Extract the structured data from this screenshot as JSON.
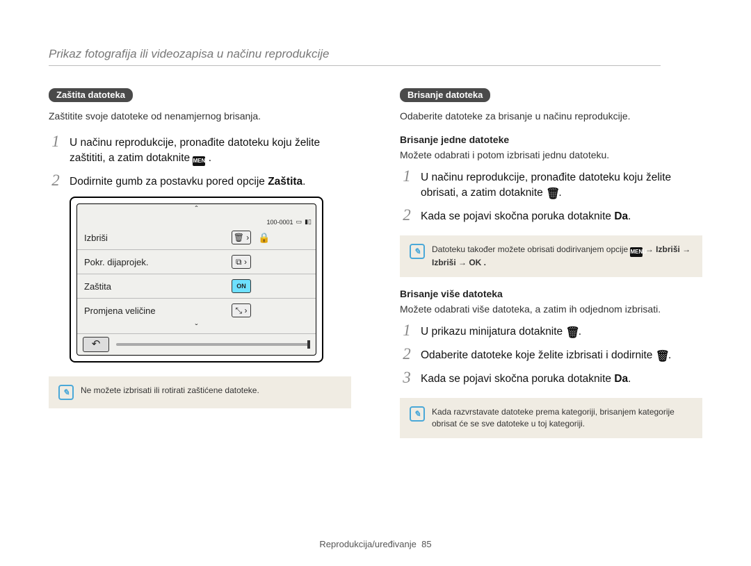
{
  "page_header": "Prikaz fotografija ili videozapisa u načinu reprodukcije",
  "footer": {
    "label": "Reprodukcija/uređivanje",
    "page": "85"
  },
  "left": {
    "pill": "Zaštita datoteka",
    "intro": "Zaštitite svoje datoteke od nenamjernog brisanja.",
    "steps": [
      "U načinu reprodukcije, pronađite datoteku koju želite zaštititi, a zatim dotaknite ",
      "Dodirnite gumb za postavku pored opcije "
    ],
    "step2_bold": "Zaštita",
    "note": "Ne možete izbrisati ili rotirati zaštićene datoteke.",
    "device": {
      "caret": "ˆ",
      "topnum": "100-0001",
      "rows": [
        {
          "label": "Izbriši",
          "icon": "🗑 ›"
        },
        {
          "label": "Pokr. dijaprojek.",
          "icon": "⧉ ›"
        },
        {
          "label": "Zaštita",
          "icon": "ON"
        },
        {
          "label": "Promjena veličine",
          "icon": "⤡ ›"
        }
      ],
      "caret_down": "ˇ",
      "back": "↶",
      "lock": "🔒"
    }
  },
  "right": {
    "pill": "Brisanje datoteka",
    "intro": "Odaberite datoteke za brisanje u načinu reprodukcije.",
    "sec1_head": "Brisanje jedne datoteke",
    "sec1_sub": "Možete odabrati i potom izbrisati jednu datoteku.",
    "sec1_steps": [
      "U načinu reprodukcije, pronađite datoteku koju želite obrisati, a zatim dotaknite ",
      "Kada se pojavi skočna poruka dotaknite "
    ],
    "da": "Da",
    "note1_a": "Datoteku također možete obrisati dodirivanjem opcije ",
    "note1_b": " → Izbriši → Izbriši → OK .",
    "sec2_head": "Brisanje više datoteka",
    "sec2_sub": "Možete odabrati više datoteka, a zatim ih odjednom izbrisati.",
    "sec2_steps": [
      "U prikazu minijatura dotaknite ",
      "Odaberite datoteke koje želite izbrisati i dodirnite ",
      "Kada se pojavi skočna poruka dotaknite "
    ],
    "note2": "Kada razvrstavate datoteke prema kategoriji, brisanjem kategorije obrisat će se sve datoteke u toj kategoriji."
  }
}
